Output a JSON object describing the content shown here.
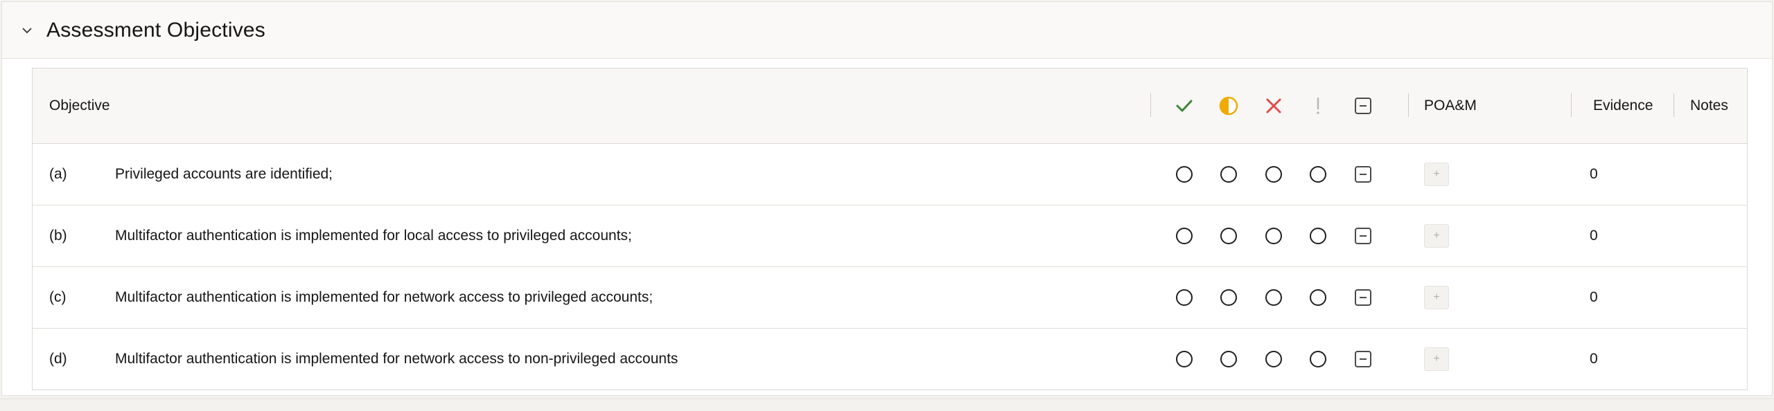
{
  "section": {
    "title": "Assessment Objectives"
  },
  "table": {
    "headers": {
      "objective": "Objective",
      "poam": "POA&M",
      "evidence": "Evidence",
      "notes": "Notes"
    },
    "status_icons": [
      "check-icon",
      "half-circle-icon",
      "x-icon",
      "exclamation-icon",
      "minus-box-icon"
    ],
    "status_glyphs": {
      "met": "✓",
      "exclaim": "!"
    },
    "add_glyph": "+",
    "rows": [
      {
        "id": "(a)",
        "text": "Privileged accounts are identified;",
        "evidence": "0"
      },
      {
        "id": "(b)",
        "text": "Multifactor authentication is implemented for local access to privileged accounts;",
        "evidence": "0"
      },
      {
        "id": "(c)",
        "text": "Multifactor authentication is implemented for network access to privileged accounts;",
        "evidence": "0"
      },
      {
        "id": "(d)",
        "text": "Multifactor authentication is implemented for network access to non-privileged accounts",
        "evidence": "0"
      }
    ]
  },
  "colors": {
    "met": "#3e8635",
    "partial": "#f0ab00",
    "not_met": "#e34a4a",
    "exclaim": "#b8b8b8",
    "na": "#4a4a4a"
  }
}
